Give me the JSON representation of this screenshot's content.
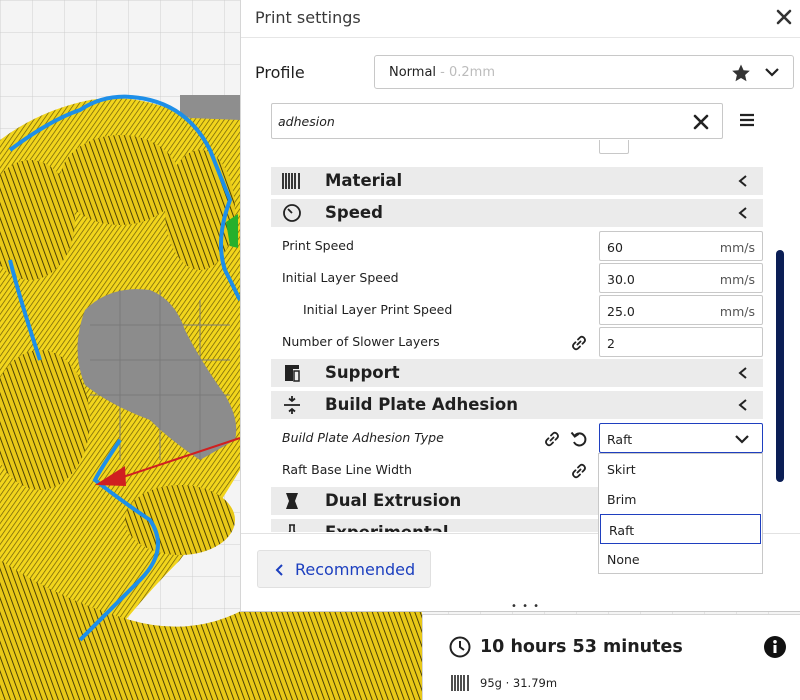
{
  "panel": {
    "title": "Print settings",
    "close_icon": "close-icon"
  },
  "profile": {
    "label": "Profile",
    "name": "Normal",
    "layer_height": " - 0.2mm"
  },
  "search": {
    "value": "adhesion"
  },
  "categories": {
    "material": "Material",
    "speed": "Speed",
    "support": "Support",
    "adhesion": "Build Plate Adhesion",
    "dual": "Dual Extrusion",
    "experimental": "Experimental"
  },
  "settings": {
    "print_speed": {
      "label": "Print Speed",
      "value": "60",
      "unit": "mm/s"
    },
    "initial_layer_speed": {
      "label": "Initial Layer Speed",
      "value": "30.0",
      "unit": "mm/s"
    },
    "initial_layer_print_speed": {
      "label": "Initial Layer Print Speed",
      "value": "25.0",
      "unit": "mm/s"
    },
    "slower_layers": {
      "label": "Number of Slower Layers",
      "value": "2"
    },
    "adhesion_type": {
      "label": "Build Plate Adhesion Type",
      "value": "Raft"
    },
    "raft_base_line_width": {
      "label": "Raft Base Line Width"
    }
  },
  "dropdown": {
    "options": [
      "Skirt",
      "Brim",
      "Raft",
      "None"
    ],
    "selected": "Raft"
  },
  "footer": {
    "recommended_label": "Recommended",
    "handle": "• • •"
  },
  "estimate": {
    "time": "10 hours 53 minutes",
    "material": "95g · 31.79m"
  },
  "colors": {
    "accent": "#1c3fbf",
    "scrollbar": "#0b1e55",
    "model_yellow": "#f2d51c",
    "model_outline": "#1e8fe8"
  }
}
